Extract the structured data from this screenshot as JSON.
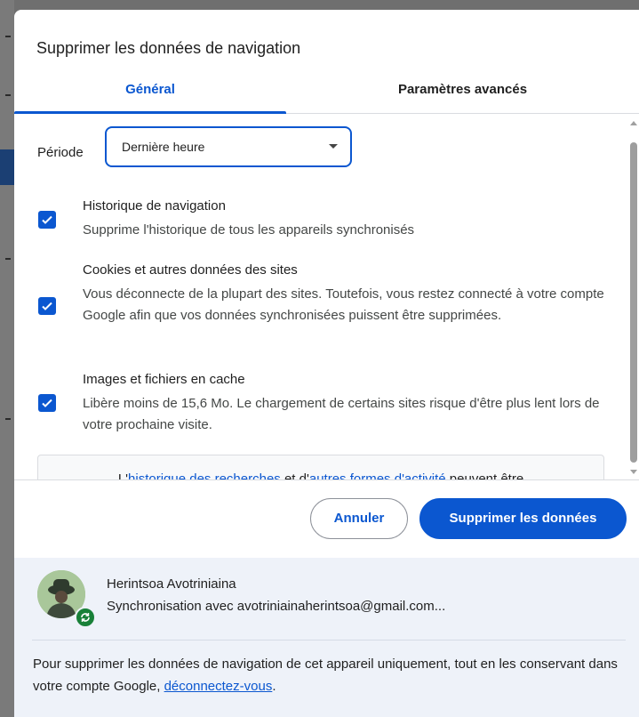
{
  "dialog": {
    "title": "Supprimer les données de navigation",
    "tabs": [
      "Général",
      "Paramètres avancés"
    ],
    "period": {
      "label": "Période",
      "value": "Dernière heure"
    },
    "options": [
      {
        "title": "Historique de navigation",
        "description": "Supprime l'historique de tous les appareils synchronisés",
        "checked": true
      },
      {
        "title": "Cookies et autres données des sites",
        "description": "Vous déconnecte de la plupart des sites. Toutefois, vous restez connecté à votre compte Google afin que vos données synchronisées puissent être supprimées.",
        "checked": true
      },
      {
        "title": "Images et fichiers en cache",
        "description": "Libère moins de 15,6 Mo. Le chargement de certains sites risque d'être plus lent lors de votre prochaine visite.",
        "checked": true
      }
    ],
    "info": {
      "prefix": "L'",
      "link1": "historique des recherches",
      "middle": " et d'",
      "link2": "autres formes d'activité",
      "suffix": " peuvent être"
    },
    "buttons": {
      "cancel": "Annuler",
      "delete": "Supprimer les données"
    }
  },
  "account": {
    "name": "Herintsoa Avotriniaina",
    "sync_text": "Synchronisation avec avotriniainaherintsoa@gmail.com...",
    "signout_text": "Pour supprimer les données de navigation de cet appareil uniquement, tout en les conservant dans votre compte Google, ",
    "signout_link": "déconnectez-vous",
    "signout_end": "."
  },
  "colors": {
    "accent": "#0b57d0",
    "account_bg": "#eef2f9",
    "sync_badge": "#188038"
  }
}
